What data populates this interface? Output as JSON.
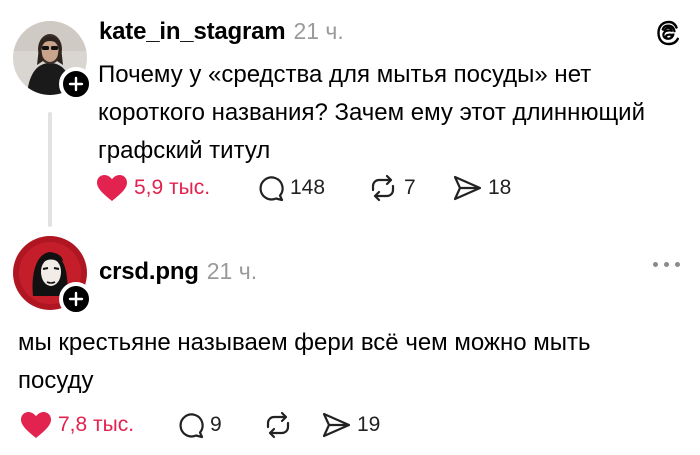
{
  "post": {
    "username": "kate_in_stagram",
    "time": "21 ч.",
    "text_lines": [
      "Почему у «средства для мытья посуды» нет",
      "короткого названия? Зачем ему этот длиннющий",
      "графский титул"
    ],
    "likes": "5,9 тыс.",
    "comments": "148",
    "reposts": "7",
    "shares": "18"
  },
  "reply": {
    "username": "crsd.png",
    "time": "21 ч.",
    "text_lines": [
      "мы крестьяне называем фери всё чем можно мыть",
      "посуду"
    ],
    "likes": "7,8 тыс.",
    "comments": "9",
    "shares": "19"
  },
  "colors": {
    "like": "#e2224f",
    "muted": "#9a9a9a"
  },
  "icons": [
    "threads-logo-icon",
    "heart-icon",
    "comment-icon",
    "repost-icon",
    "share-icon",
    "more-icon",
    "plus-icon"
  ]
}
